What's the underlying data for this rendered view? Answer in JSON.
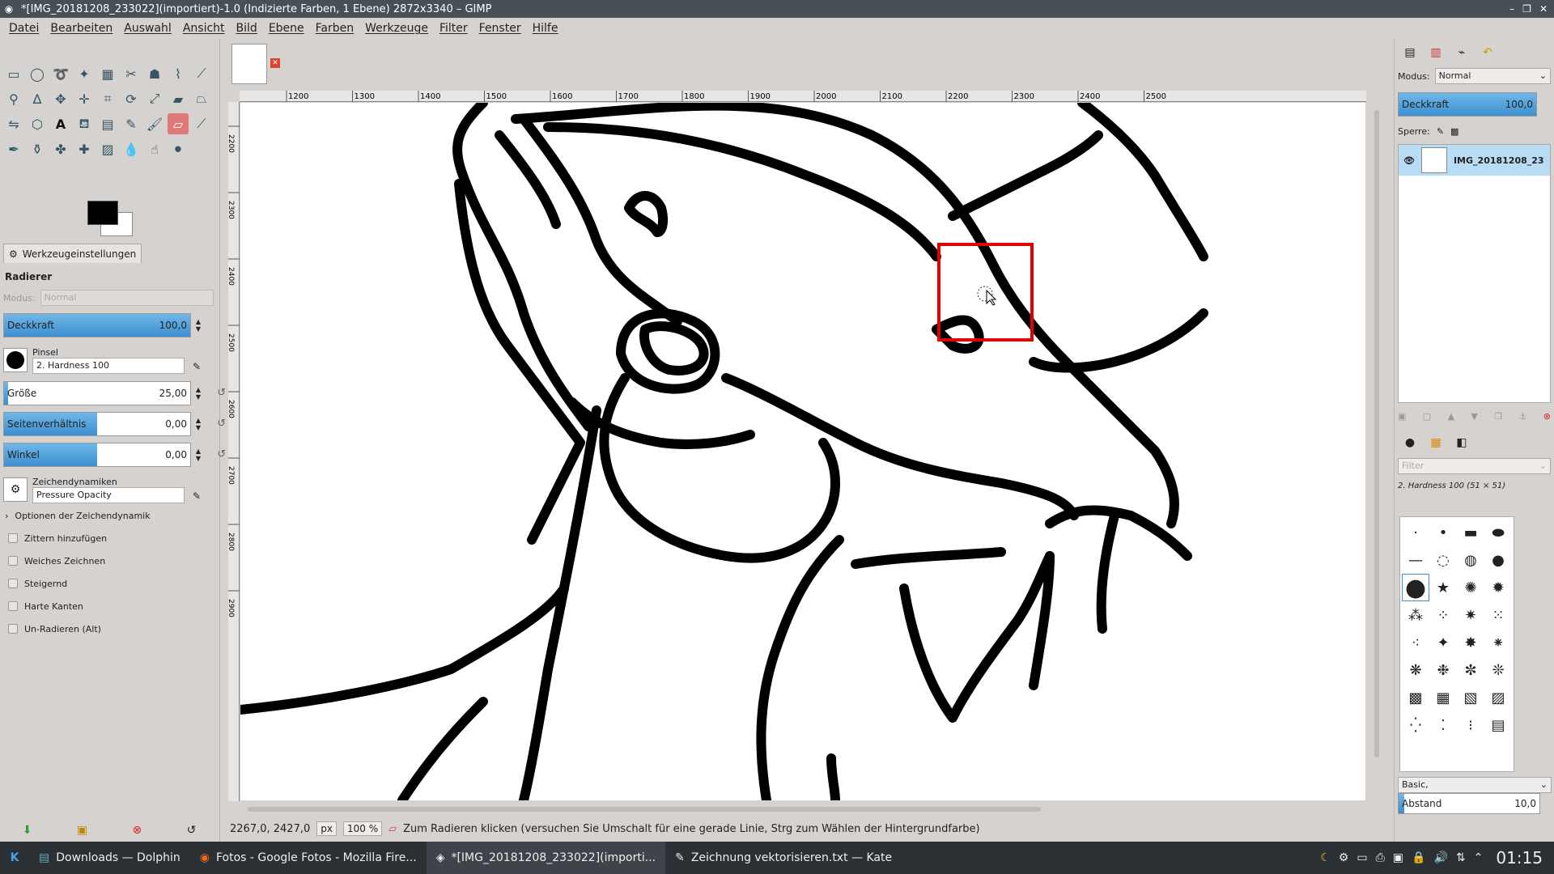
{
  "window": {
    "title": "*[IMG_20181208_233022](importiert)-1.0 (Indizierte Farben, 1 Ebene) 2872x3340 – GIMP",
    "controls": [
      "–",
      "❐",
      "✕"
    ]
  },
  "menu": [
    "Datei",
    "Bearbeiten",
    "Auswahl",
    "Ansicht",
    "Bild",
    "Ebene",
    "Farben",
    "Werkzeuge",
    "Filter",
    "Fenster",
    "Hilfe"
  ],
  "tool_options": {
    "tab_label": "Werkzeugeinstellungen",
    "tool_name": "Radierer",
    "mode_label": "Modus:",
    "mode_value": "Normal",
    "opacity": {
      "label": "Deckkraft",
      "value": "100,0",
      "fraction": 1.0
    },
    "brush_label": "Pinsel",
    "brush_value": "2. Hardness 100",
    "size": {
      "label": "Größe",
      "value": "25,00",
      "fraction": 0.02
    },
    "aspect": {
      "label": "Seitenverhältnis",
      "value": "0,00",
      "fraction": 0.5
    },
    "angle": {
      "label": "Winkel",
      "value": "0,00",
      "fraction": 0.5
    },
    "dynamics_label": "Zeichendynamiken",
    "dynamics_value": "Pressure Opacity",
    "dynamics_options": "Optionen der Zeichendynamik",
    "checks": [
      "Zittern hinzufügen",
      "Weiches Zeichnen",
      "Steigernd",
      "Harte Kanten",
      "Un-Radieren  (Alt)"
    ]
  },
  "ruler": {
    "h_labels": [
      "1200",
      "1300",
      "1400",
      "1500",
      "1600",
      "1700",
      "1800",
      "1900",
      "2000",
      "2100",
      "2200",
      "2300",
      "2400",
      "2500"
    ],
    "v_labels": [
      "2200",
      "2300",
      "2400",
      "2500",
      "2600",
      "2700",
      "2800",
      "2900"
    ]
  },
  "status": {
    "coords": "2267,0, 2427,0",
    "unit": "px",
    "zoom": "100 %",
    "message": "Zum Radieren klicken (versuchen Sie Umschalt für eine gerade Linie, Strg zum Wählen der Hintergrundfarbe)"
  },
  "layers": {
    "mode_label": "Modus:",
    "mode_value": "Normal",
    "opacity_label": "Deckkraft",
    "opacity_value": "100,0",
    "lock_label": "Sperre:",
    "layer_name": "IMG_20181208_23"
  },
  "brushes": {
    "filter_placeholder": "Filter",
    "current": "2. Hardness 100 (51 × 51)",
    "tag": "Basic,",
    "spacing_label": "Abstand",
    "spacing_value": "10,0"
  },
  "taskbar": {
    "items": [
      {
        "label": "Downloads — Dolphin",
        "icon": "folder-icon"
      },
      {
        "label": "Fotos - Google Fotos - Mozilla Fire...",
        "icon": "firefox-icon"
      },
      {
        "label": "*[IMG_20181208_233022](importi...",
        "icon": "gimp-icon"
      },
      {
        "label": "Zeichnung vektorisieren.txt  — Kate",
        "icon": "kate-icon"
      }
    ],
    "clock": "01:15"
  },
  "colors": {
    "accent": "#3d8fd1",
    "highlight_box": "#e00000",
    "taskbar": "#2b3034"
  }
}
